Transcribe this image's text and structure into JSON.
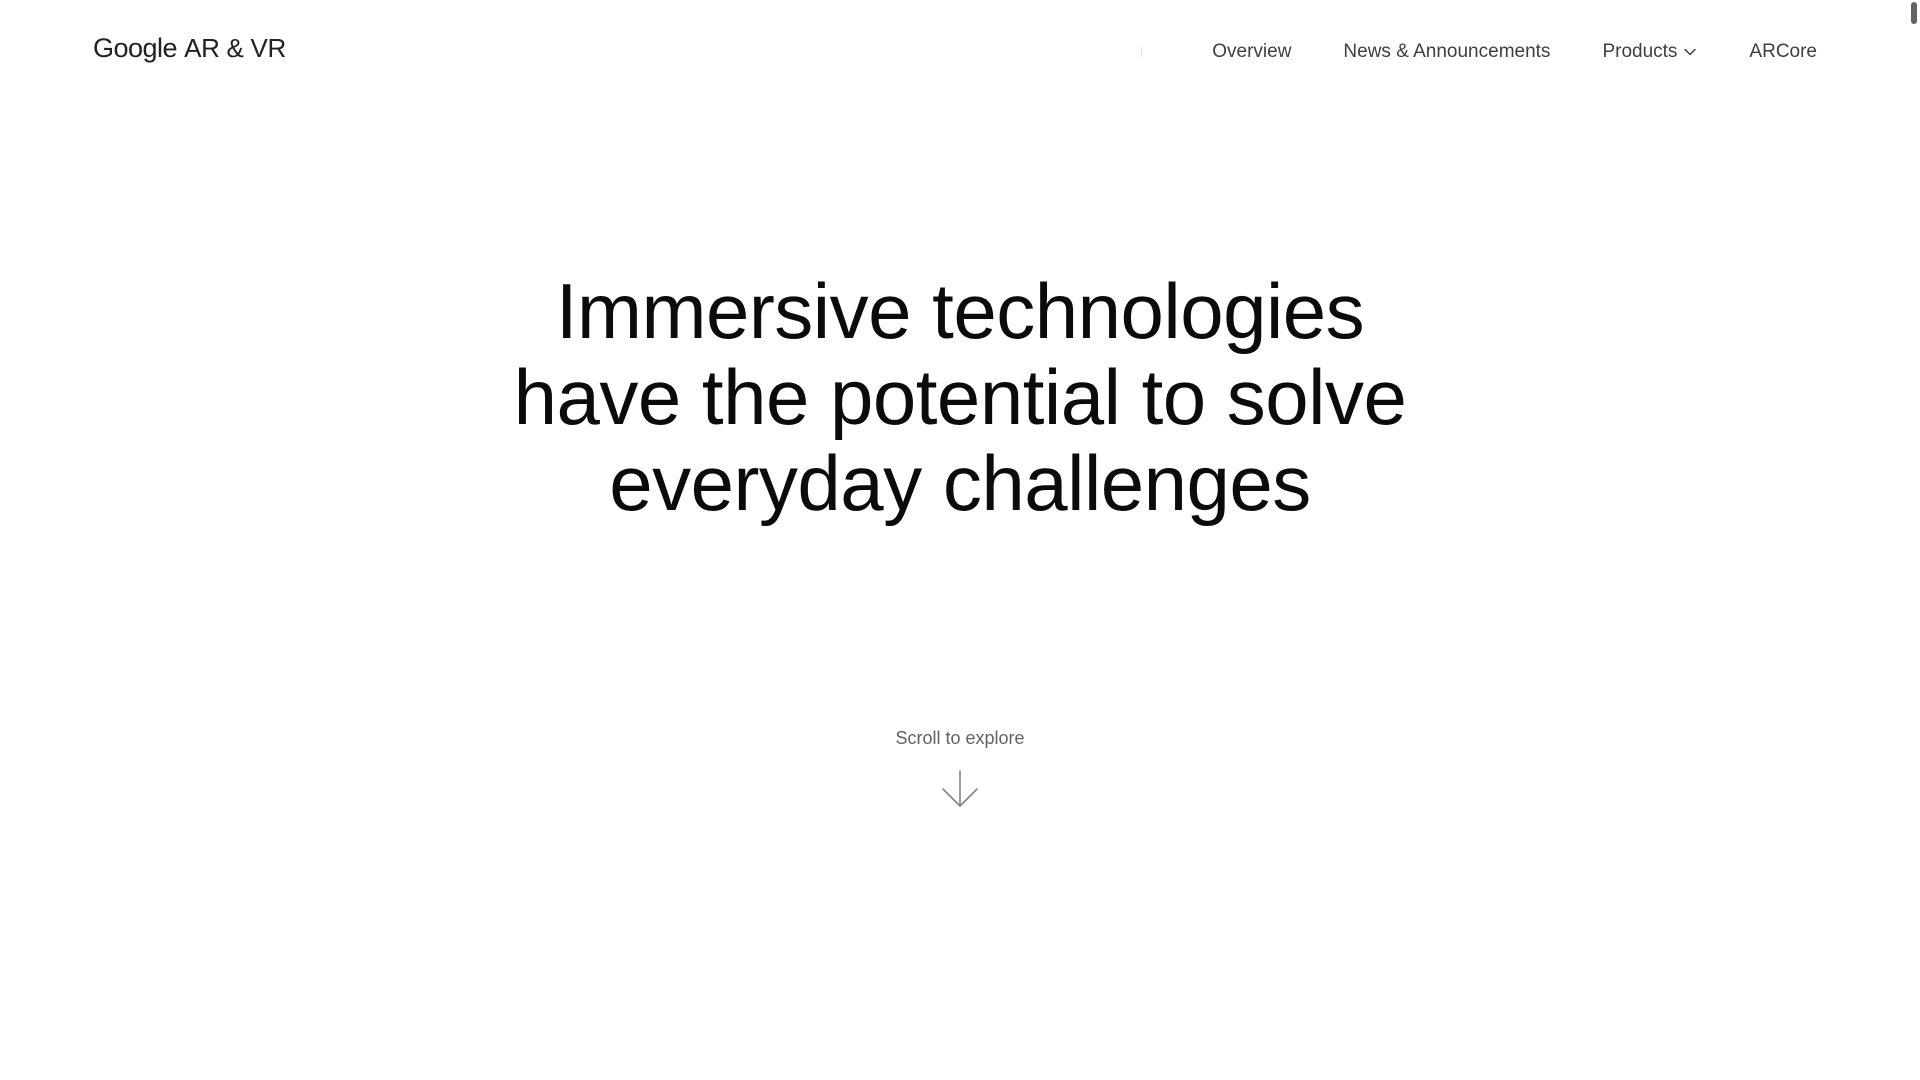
{
  "header": {
    "brand": {
      "google": "Google",
      "product": "AR & VR"
    },
    "nav": [
      {
        "label": "Overview"
      },
      {
        "label": "News & Announcements"
      },
      {
        "label": "Products",
        "has_dropdown": true
      },
      {
        "label": "ARCore"
      }
    ]
  },
  "hero": {
    "title_lines": [
      "Immersive technologies",
      "have the potential to solve",
      "everyday challenges"
    ]
  },
  "scroll_cue": {
    "label": "Scroll to explore",
    "icon": "arrow-down-icon"
  },
  "colors": {
    "text_primary": "#0b0b0b",
    "nav_text": "#3c4043",
    "muted_text": "#5f6368",
    "background": "#ffffff"
  }
}
